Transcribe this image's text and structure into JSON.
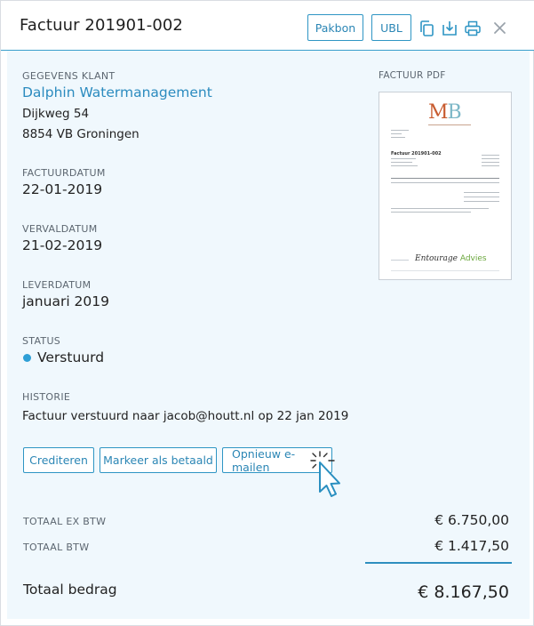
{
  "header": {
    "title": "Factuur 201901-002",
    "buttons": {
      "pakbon": "Pakbon",
      "ubl": "UBL"
    },
    "icons": [
      "copy-icon",
      "download-icon",
      "print-icon",
      "close-icon"
    ]
  },
  "client": {
    "label": "GEGEVENS KLANT",
    "name": "Dalphin Watermanagement",
    "address": "Dijkweg 54",
    "city": "8854 VB Groningen"
  },
  "invoice": {
    "factuurdatum_label": "FACTUURDATUM",
    "factuurdatum": "22-01-2019",
    "vervaldatum_label": "VERVALDATUM",
    "vervaldatum": "21-02-2019",
    "leverdatum_label": "LEVERDATUM",
    "leverdatum": "januari 2019",
    "status_label": "STATUS",
    "status": "Verstuurd",
    "historie_label": "HISTORIE",
    "historie": "Factuur verstuurd naar jacob@houtt.nl op 22 jan 2019"
  },
  "actions": {
    "crediteren": "Crediteren",
    "markeer": "Markeer als betaald",
    "email": "Opnieuw e-mailen"
  },
  "totals": {
    "ex_btw_label": "TOTAAL EX BTW",
    "ex_btw": "€ 6.750,00",
    "btw_label": "TOTAAL BTW",
    "btw": "€ 1.417,50",
    "total_label": "Totaal bedrag",
    "total": "€ 8.167,50"
  },
  "pdf": {
    "label": "FACTUUR PDF",
    "logo_m": "M",
    "logo_b": "B",
    "doc_title": "Factuur 201901-002",
    "footer_logo_main": "Entourage",
    "footer_logo_accent": "Advies"
  },
  "colors": {
    "accent": "#2e95c4",
    "status_dot": "#2e9fd6",
    "panel_bg": "#f0f8fd"
  }
}
